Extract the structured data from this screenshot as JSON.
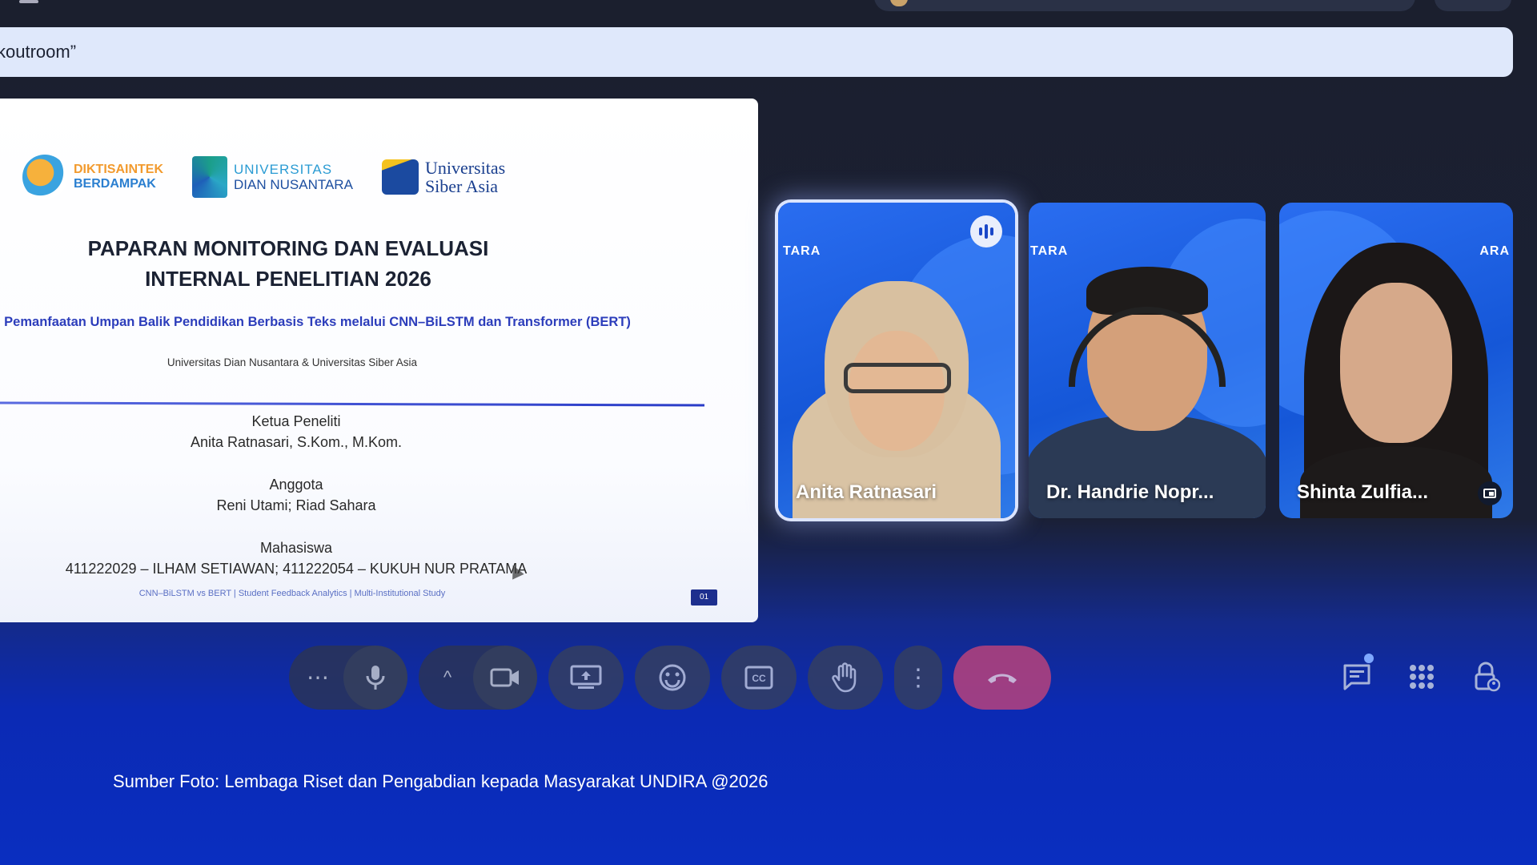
{
  "banner": {
    "text": "koutroom”"
  },
  "slide": {
    "logos": [
      {
        "line1": "DIKTISAINTEK",
        "line2": "BERDAMPAK"
      },
      {
        "line1": "UNIVERSITAS",
        "line2": "DIAN NUSANTARA"
      },
      {
        "line1": "Universitas",
        "line2": "Siber Asia"
      }
    ],
    "title_line1": "PAPARAN MONITORING DAN EVALUASI",
    "title_line2": "INTERNAL PENELITIAN 2026",
    "subtitle": "i Pemanfaatan Umpan Balik Pendidikan Berbasis Teks melalui CNN–BiLSTM dan Transformer (BERT)",
    "affiliation": "Universitas Dian Nusantara & Universitas Siber Asia",
    "leader_label": "Ketua Peneliti",
    "leader_name": "Anita Ratnasari, S.Kom., M.Kom.",
    "members_label": "Anggota",
    "members": "Reni Utami; Riad Sahara",
    "students_label": "Mahasiswa",
    "students": "411222029 – ILHAM SETIAWAN; 411222054 – KUKUH NUR PRATAMA",
    "footer": "CNN–BiLSTM vs BERT | Student Feedback Analytics | Multi-Institutional Study",
    "page_number": "01"
  },
  "participants": [
    {
      "name": "Anita Ratnasari",
      "brand": "TARA",
      "speaking": true
    },
    {
      "name": "Dr. Handrie Nopr...",
      "brand": "TARA",
      "speaking": false
    },
    {
      "name": "Shinta Zulfia...",
      "brand": "ARA",
      "speaking": false
    }
  ],
  "controls": {
    "more_options": "more-horiz-icon",
    "mic": "mic-icon",
    "camera_options": "chevron-up-icon",
    "camera": "videocam-icon",
    "present": "present-screen-icon",
    "reactions": "emoji-icon",
    "captions": "closed-caption-icon",
    "raise_hand": "hand-icon",
    "more": "more-vert-icon",
    "leave": "call-end-icon",
    "chat": "chat-icon",
    "activities": "apps-icon",
    "host_controls": "lock-person-icon"
  },
  "colors": {
    "end_call": "#c2437a",
    "speaking_glow": "#dbe4ff",
    "slide_accent": "#2c3dbb"
  },
  "caption": "Sumber Foto: Lembaga Riset dan Pengabdian kepada Masyarakat UNDIRA @2026"
}
